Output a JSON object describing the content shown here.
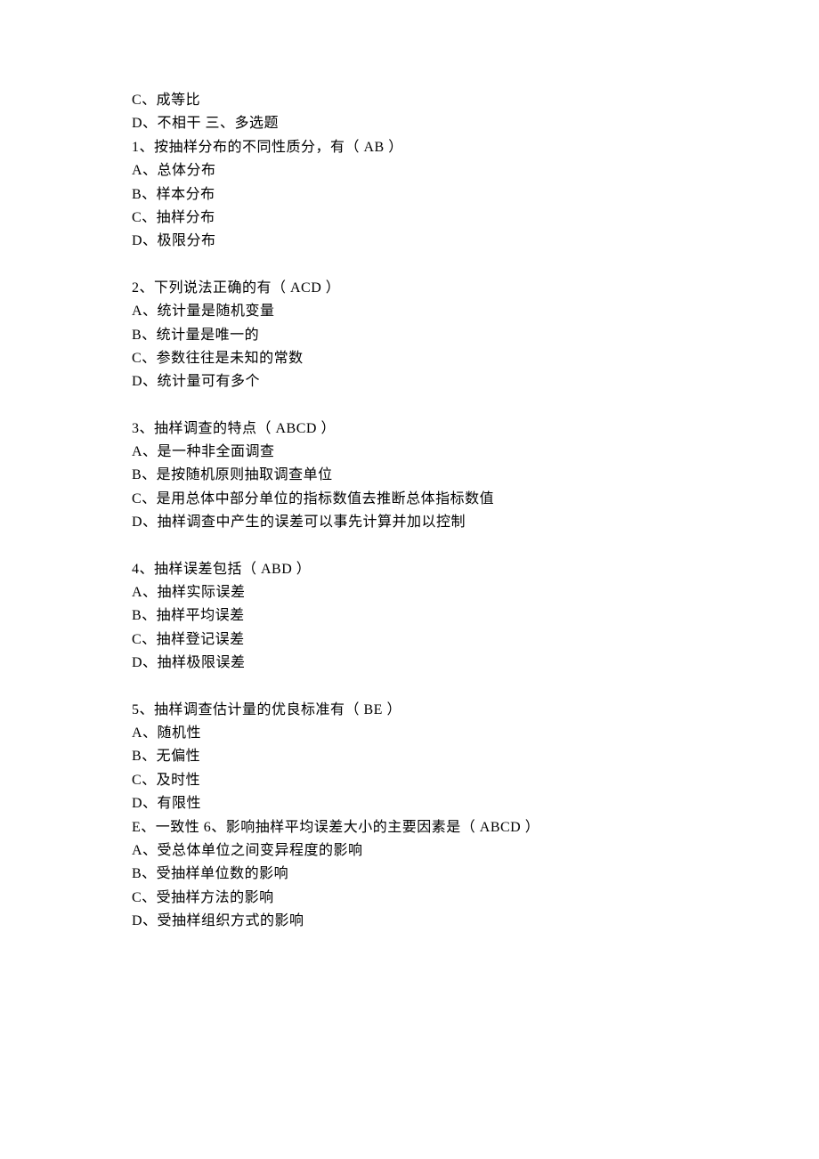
{
  "intro": {
    "optionC": "C、成等比",
    "optionD_and_section": "D、不相干 三、多选题"
  },
  "questions": [
    {
      "stem": "1、按抽样分布的不同性质分，有（ AB ）",
      "options": [
        "A、总体分布",
        "B、样本分布",
        "C、抽样分布",
        "D、极限分布"
      ]
    },
    {
      "stem": "2、下列说法正确的有（ ACD ）",
      "options": [
        "A、统计量是随机变量",
        "B、统计量是唯一的",
        "C、参数往往是未知的常数",
        "D、统计量可有多个"
      ]
    },
    {
      "stem": "3、抽样调查的特点（ ABCD ）",
      "options": [
        "A、是一种非全面调查",
        "B、是按随机原则抽取调查单位",
        "C、是用总体中部分单位的指标数值去推断总体指标数值",
        "D、抽样调查中产生的误差可以事先计算并加以控制"
      ]
    },
    {
      "stem": "4、抽样误差包括（ ABD ）",
      "options": [
        "A、抽样实际误差",
        "B、抽样平均误差",
        "C、抽样登记误差",
        "D、抽样极限误差"
      ]
    },
    {
      "stem": "5、抽样调查估计量的优良标准有（ BE ）",
      "options": [
        "A、随机性",
        "B、无偏性",
        "C、及时性",
        "D、有限性",
        "E、一致性 6、影响抽样平均误差大小的主要因素是（ ABCD ）",
        "A、受总体单位之间变异程度的影响",
        "B、受抽样单位数的影响",
        "C、受抽样方法的影响",
        "D、受抽样组织方式的影响"
      ]
    }
  ]
}
